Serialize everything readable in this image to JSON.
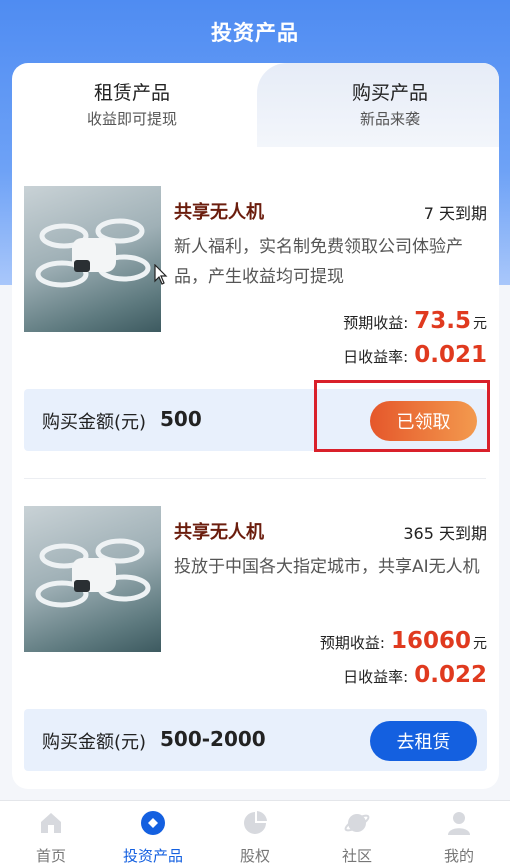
{
  "header": {
    "title": "投资产品"
  },
  "tabs": [
    {
      "title": "租赁产品",
      "subtitle": "收益即可提现"
    },
    {
      "title": "购买产品",
      "subtitle": "新品来袭"
    }
  ],
  "products": [
    {
      "name": "共享无人机",
      "term": "7 天到期",
      "description": "新人福利，实名制免费领取公司体验产品，产生收益均可提现",
      "yield_label": "预期收益:",
      "yield_value": "73.5",
      "yield_unit": "元",
      "rate_label": "日收益率:",
      "rate_value": "0.021",
      "amount_label": "购买金额(元)",
      "amount_value": "500",
      "button_label": "已领取"
    },
    {
      "name": "共享无人机",
      "term": "365 天到期",
      "description": "投放于中国各大指定城市，共享AI无人机",
      "yield_label": "预期收益:",
      "yield_value": "16060",
      "yield_unit": "元",
      "rate_label": "日收益率:",
      "rate_value": "0.022",
      "amount_label": "购买金额(元)",
      "amount_value": "500-2000",
      "button_label": "去租赁"
    }
  ],
  "tabbar": {
    "items": [
      {
        "label": "首页",
        "icon": "home-icon"
      },
      {
        "label": "投资产品",
        "icon": "invest-icon"
      },
      {
        "label": "股权",
        "icon": "pie-chart-icon"
      },
      {
        "label": "社区",
        "icon": "planet-icon"
      },
      {
        "label": "我的",
        "icon": "user-icon"
      }
    ],
    "active": "投资产品"
  },
  "colors": {
    "primary": "#1460e0",
    "accent_red": "#e03a1f",
    "product_name": "#6b1d0d",
    "claimed_button": "#e5572b",
    "highlight_box": "#d9202a"
  }
}
